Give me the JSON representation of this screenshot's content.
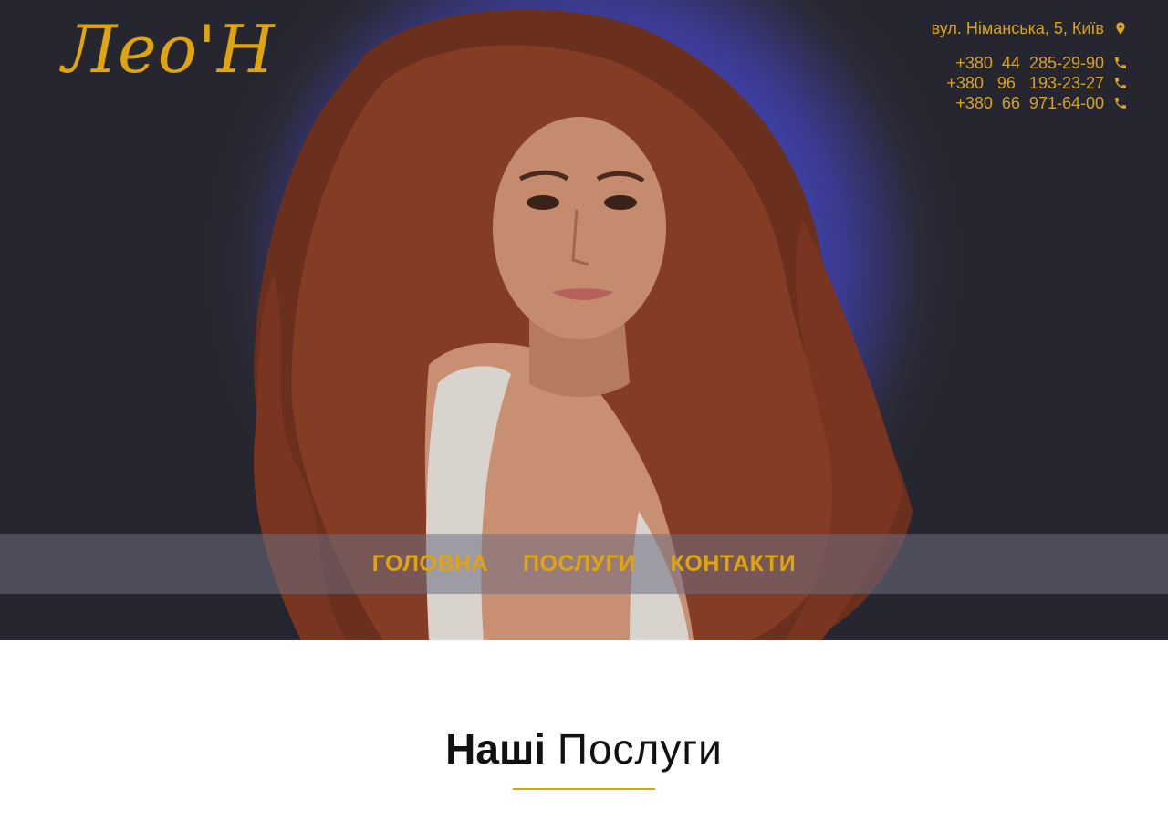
{
  "header": {
    "logo_text": "Лео'Н",
    "address": "вул. Німанська, 5, Київ",
    "phones": [
      "+380  44  285-29-90",
      "+380   96   193-23-27",
      "+380  66  971-64-00"
    ]
  },
  "nav": {
    "items": [
      "ГОЛОВНА",
      "ПОСЛУГИ",
      "КОНТАКТИ"
    ]
  },
  "services": {
    "title_bold": "Наші",
    "title_light": "Послуги"
  },
  "colors": {
    "accent": "#e0a50e",
    "hero_bg": "#4447c2",
    "dark_bg": "#262630"
  },
  "icons": {
    "address": "map-marker-icon",
    "phone": "phone-icon"
  }
}
